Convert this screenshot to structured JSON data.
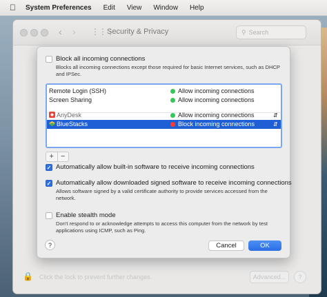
{
  "menubar": {
    "apple_icon": "apple-logo-icon",
    "app_name": "System Preferences",
    "items": [
      "Edit",
      "View",
      "Window",
      "Help"
    ]
  },
  "prefs_window": {
    "title": "Security & Privacy",
    "search_placeholder": "Search",
    "lock_text": "Click the lock to prevent further changes.",
    "advanced_label": "Advanced...",
    "help_label": "?"
  },
  "firewall_sheet": {
    "block_all": {
      "checked": false,
      "label": "Block all incoming connections",
      "description": "Blocks all incoming connections except those required for basic Internet services, such as DHCP and IPSec."
    },
    "services": [
      {
        "name": "Remote Login (SSH)",
        "status": "Allow incoming connections",
        "status_color": "#34c759",
        "has_stepper": false,
        "selected": false
      },
      {
        "name": "Screen Sharing",
        "status": "Allow incoming connections",
        "status_color": "#34c759",
        "has_stepper": false,
        "selected": false
      },
      {
        "name": "AnyDesk",
        "icon": "anydesk-app-icon",
        "status": "Allow incoming connections",
        "status_color": "#34c759",
        "has_stepper": true,
        "selected": false
      },
      {
        "name": "BlueStacks",
        "icon": "bluestacks-app-icon",
        "status": "Block incoming connections",
        "status_color": "#ff3b30",
        "has_stepper": true,
        "selected": true
      }
    ],
    "add_label": "+",
    "remove_label": "−",
    "auto_builtin": {
      "checked": true,
      "label": "Automatically allow built-in software to receive incoming connections"
    },
    "auto_signed": {
      "checked": true,
      "label": "Automatically allow downloaded signed software to receive incoming connections",
      "description": "Allows software signed by a valid certificate authority to provide services accessed from the network."
    },
    "stealth": {
      "checked": false,
      "label": "Enable stealth mode",
      "description": "Don't respond to or acknowledge attempts to access this computer from the network by test applications using ICMP, such as Ping."
    },
    "help_label": "?",
    "cancel_label": "Cancel",
    "ok_label": "OK",
    "accent_color": "#2a6fe6"
  }
}
